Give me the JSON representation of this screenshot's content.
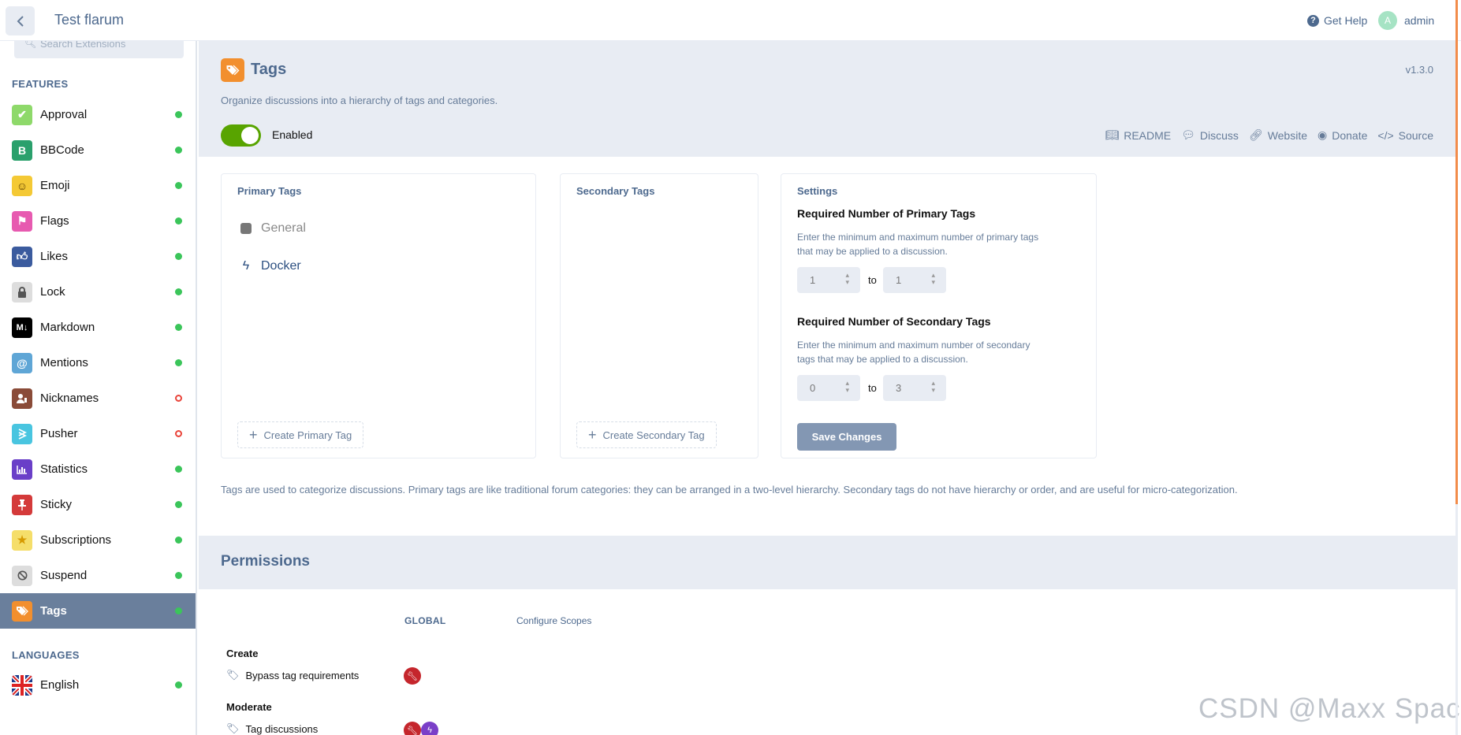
{
  "header": {
    "forum_title": "Test flarum",
    "help_label": "Get Help",
    "user_initial": "A",
    "username": "admin"
  },
  "sidebar": {
    "search_placeholder": "Search Extensions",
    "features_heading": "FEATURES",
    "languages_heading": "LANGUAGES",
    "items": [
      {
        "label": "Approval",
        "icon": "check-icon",
        "color": "#8ed96a",
        "enabled": true
      },
      {
        "label": "BBCode",
        "icon": "bbcode-icon",
        "color": "#2aa06c",
        "enabled": true
      },
      {
        "label": "Emoji",
        "icon": "smile-icon",
        "color": "#f4c935",
        "enabled": true
      },
      {
        "label": "Flags",
        "icon": "flag-icon",
        "color": "#e75ab0",
        "enabled": true
      },
      {
        "label": "Likes",
        "icon": "thumbs-up-icon",
        "color": "#3b5b9e",
        "enabled": true
      },
      {
        "label": "Lock",
        "icon": "lock-icon",
        "color": "#dddddd",
        "enabled": true
      },
      {
        "label": "Markdown",
        "icon": "markdown-icon",
        "color": "#000000",
        "enabled": true
      },
      {
        "label": "Mentions",
        "icon": "at-icon",
        "color": "#5fa6d6",
        "enabled": true
      },
      {
        "label": "Nicknames",
        "icon": "user-edit-icon",
        "color": "#8a4b38",
        "enabled": false
      },
      {
        "label": "Pusher",
        "icon": "pusher-icon",
        "color": "#49c5e0",
        "enabled": false
      },
      {
        "label": "Statistics",
        "icon": "chart-icon",
        "color": "#6a3fc8",
        "enabled": true
      },
      {
        "label": "Sticky",
        "icon": "thumbtack-icon",
        "color": "#d43a3a",
        "enabled": true
      },
      {
        "label": "Subscriptions",
        "icon": "star-icon",
        "color": "#f5de6a",
        "enabled": true
      },
      {
        "label": "Suspend",
        "icon": "ban-icon",
        "color": "#dddddd",
        "enabled": true
      },
      {
        "label": "Tags",
        "icon": "tags-icon",
        "color": "#f28f2e",
        "enabled": true,
        "active": true
      }
    ],
    "languages": [
      {
        "label": "English",
        "icon": "uk-flag-icon",
        "enabled": true
      }
    ]
  },
  "extension": {
    "title": "Tags",
    "version": "v1.3.0",
    "description": "Organize discussions into a hierarchy of tags and categories.",
    "toggle_label": "Enabled",
    "toggle_on": true,
    "links": [
      "README",
      "Discuss",
      "Website",
      "Donate",
      "Source"
    ]
  },
  "primary_tags": {
    "heading": "Primary Tags",
    "tags": [
      {
        "name": "General",
        "color": "#777777"
      },
      {
        "name": "Docker",
        "color": "#2c4f80"
      }
    ],
    "create_label": "Create Primary Tag"
  },
  "secondary_tags": {
    "heading": "Secondary Tags",
    "create_label": "Create Secondary Tag"
  },
  "settings": {
    "heading": "Settings",
    "primary_title": "Required Number of Primary Tags",
    "primary_desc": "Enter the minimum and maximum number of primary tags that may be applied to a discussion.",
    "primary_min": "1",
    "primary_max": "1",
    "secondary_title": "Required Number of Secondary Tags",
    "secondary_desc": "Enter the minimum and maximum number of secondary tags that may be applied to a discussion.",
    "secondary_min": "0",
    "secondary_max": "3",
    "to_label": "to",
    "save_label": "Save Changes"
  },
  "info_text": "Tags are used to categorize discussions. Primary tags are like traditional forum categories: they can be arranged in a two-level hierarchy. Secondary tags do not have hierarchy or order, and are useful for micro-categorization.",
  "permissions": {
    "title": "Permissions",
    "col_global": "GLOBAL",
    "col_scopes": "Configure Scopes",
    "group_create": "Create",
    "bypass_label": "Bypass tag requirements",
    "group_moderate": "Moderate",
    "tag_disc_label": "Tag discussions"
  },
  "watermark": "CSDN @Maxx Space"
}
